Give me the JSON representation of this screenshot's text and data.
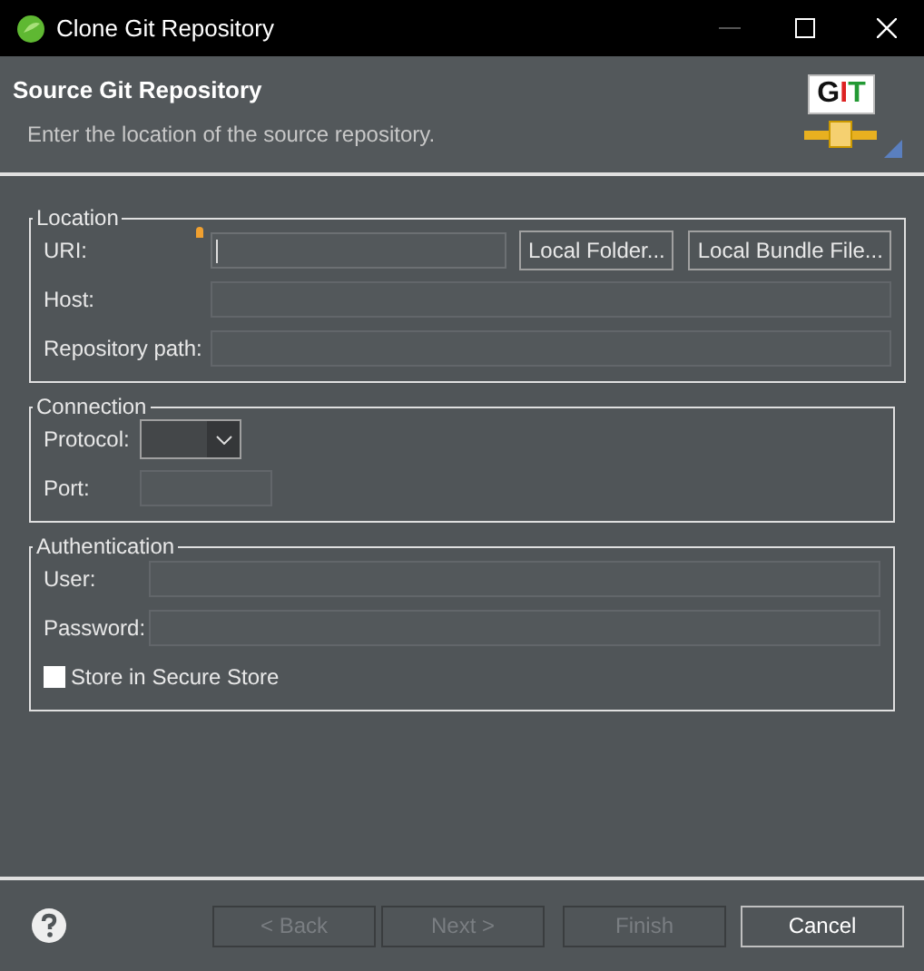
{
  "window": {
    "title": "Clone Git Repository"
  },
  "header": {
    "title": "Source Git Repository",
    "description": "Enter the location of the source repository.",
    "logo_text": "GIT"
  },
  "groups": [
    {
      "title": "Location",
      "rows": [
        {
          "kind": "text",
          "label": "URI:",
          "required": true,
          "buttons": [
            "Local Folder...",
            "Local Bundle File..."
          ]
        },
        {
          "kind": "text",
          "label": "Host:",
          "required": false
        },
        {
          "kind": "text",
          "label": "Repository path:",
          "required": false
        }
      ]
    },
    {
      "title": "Connection",
      "rows": [
        {
          "kind": "combo",
          "label": "Protocol:"
        },
        {
          "kind": "short",
          "label": "Port:"
        }
      ]
    },
    {
      "title": "Authentication",
      "rows": [
        {
          "kind": "text",
          "label": "User:",
          "required": false
        },
        {
          "kind": "text",
          "label": "Password:",
          "required": false
        },
        {
          "kind": "checkbox",
          "label": "Store in Secure Store",
          "checked": false
        }
      ]
    }
  ],
  "buttons": [
    {
      "label": "< Back",
      "disabled": true
    },
    {
      "label": "Next >",
      "disabled": true
    },
    {
      "label": "Finish",
      "disabled": true
    },
    {
      "label": "Cancel",
      "disabled": false
    }
  ]
}
